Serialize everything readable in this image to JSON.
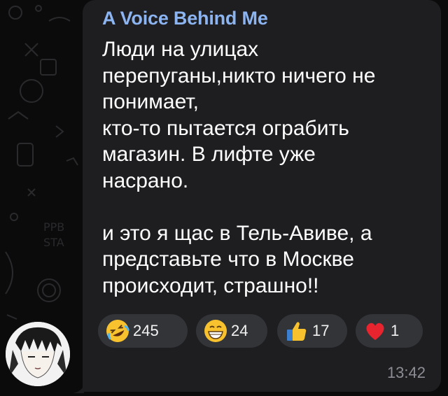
{
  "message": {
    "author": "A Voice Behind Me",
    "lines": [
      "Люди на улицах",
      "перепуганы,никто ничего не",
      "понимает,",
      "кто-то пытается ограбить",
      "магазин. В лифте уже",
      "насрано."
    ],
    "lines2": [
      "и это я щас в Тель-Авиве, а",
      "представьте что в Москве",
      "происходит, страшно!!"
    ],
    "time": "13:42"
  },
  "reactions": [
    {
      "icon": "rofl-emoji-icon",
      "count": "245"
    },
    {
      "icon": "grin-emoji-icon",
      "count": "24"
    },
    {
      "icon": "thumbs-up-emoji-icon",
      "count": "17"
    },
    {
      "icon": "red-heart-emoji-icon",
      "count": "1"
    }
  ],
  "colors": {
    "background": "#0b0b0c",
    "bubble": "#1e1e21",
    "author": "#8cb4f0",
    "reaction_pill": "#333438",
    "time": "#8d8e93"
  }
}
